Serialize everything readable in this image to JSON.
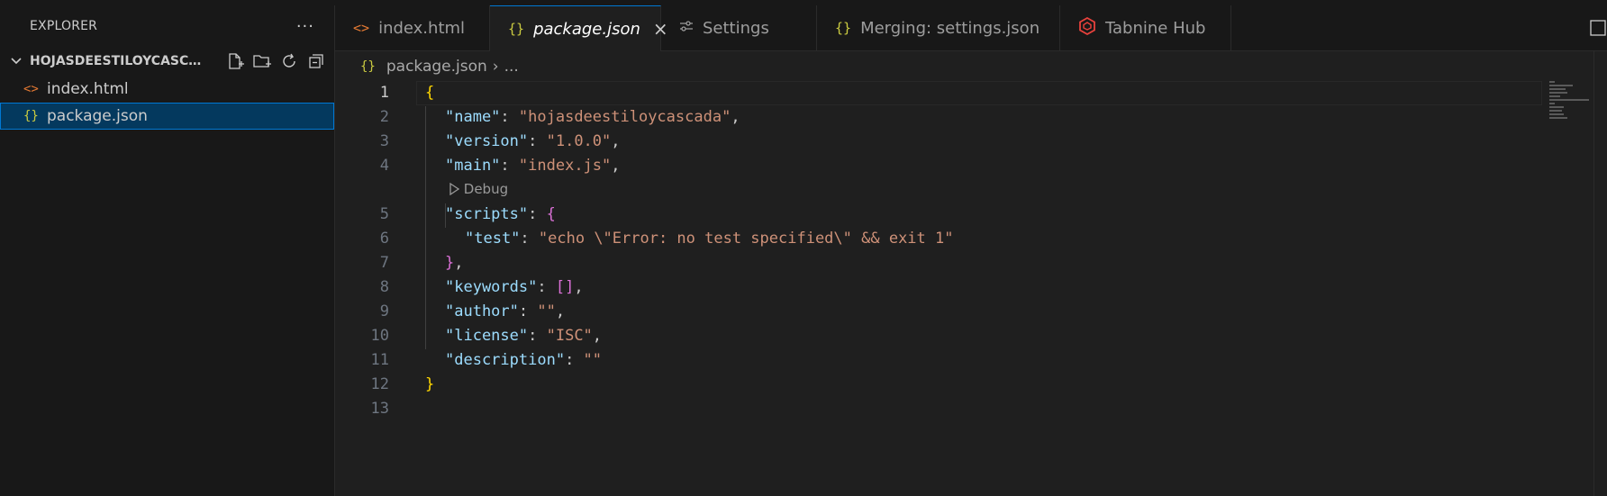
{
  "sidebar": {
    "title": "EXPLORER",
    "more": "···",
    "folder": "HOJASDEESTILOYCASCA...",
    "files": [
      {
        "icon": "<>",
        "name": "index.html"
      },
      {
        "icon": "{}",
        "name": "package.json"
      }
    ]
  },
  "tabs": [
    {
      "icon": "<>",
      "label": "index.html"
    },
    {
      "icon": "{}",
      "label": "package.json",
      "close": "×"
    },
    {
      "icon": "⚯",
      "label": "Settings"
    },
    {
      "icon": "{}",
      "label": "Merging: settings.json"
    },
    {
      "icon": "⬡",
      "label": "Tabnine Hub"
    }
  ],
  "breadcrumb": {
    "icon": "{}",
    "file": "package.json",
    "sep": "›",
    "rest": "..."
  },
  "editor": {
    "line_numbers": [
      "1",
      "2",
      "3",
      "4",
      "5",
      "6",
      "7",
      "8",
      "9",
      "10",
      "11",
      "12",
      "13"
    ],
    "codelens": "Debug",
    "lines": [
      {
        "open": "{"
      },
      {
        "key": "\"name\"",
        "colon": ": ",
        "value": "\"hojasdeestiloycascada\"",
        "comma": ","
      },
      {
        "key": "\"version\"",
        "colon": ": ",
        "value": "\"1.0.0\"",
        "comma": ","
      },
      {
        "key": "\"main\"",
        "colon": ": ",
        "value": "\"index.js\"",
        "comma": ","
      },
      {
        "key": "\"scripts\"",
        "colon": ": ",
        "open": "{"
      },
      {
        "key": "\"test\"",
        "colon": ": ",
        "value": "\"echo \\\"Error: no test specified\\\" && exit 1\""
      },
      {
        "close": "}",
        "comma": ","
      },
      {
        "key": "\"keywords\"",
        "colon": ": ",
        "value": "[]",
        "comma": ","
      },
      {
        "key": "\"author\"",
        "colon": ": ",
        "value": "\"\"",
        "comma": ","
      },
      {
        "key": "\"license\"",
        "colon": ": ",
        "value": "\"ISC\"",
        "comma": ","
      },
      {
        "key": "\"description\"",
        "colon": ": ",
        "value": "\"\""
      },
      {
        "close": "}"
      }
    ]
  },
  "colors": {
    "accent": "#0078d4",
    "json_icon": "#cbcb41",
    "html_icon": "#e37933",
    "key": "#9cdcfe",
    "string": "#ce9178",
    "tabnine": "#e8413c"
  }
}
